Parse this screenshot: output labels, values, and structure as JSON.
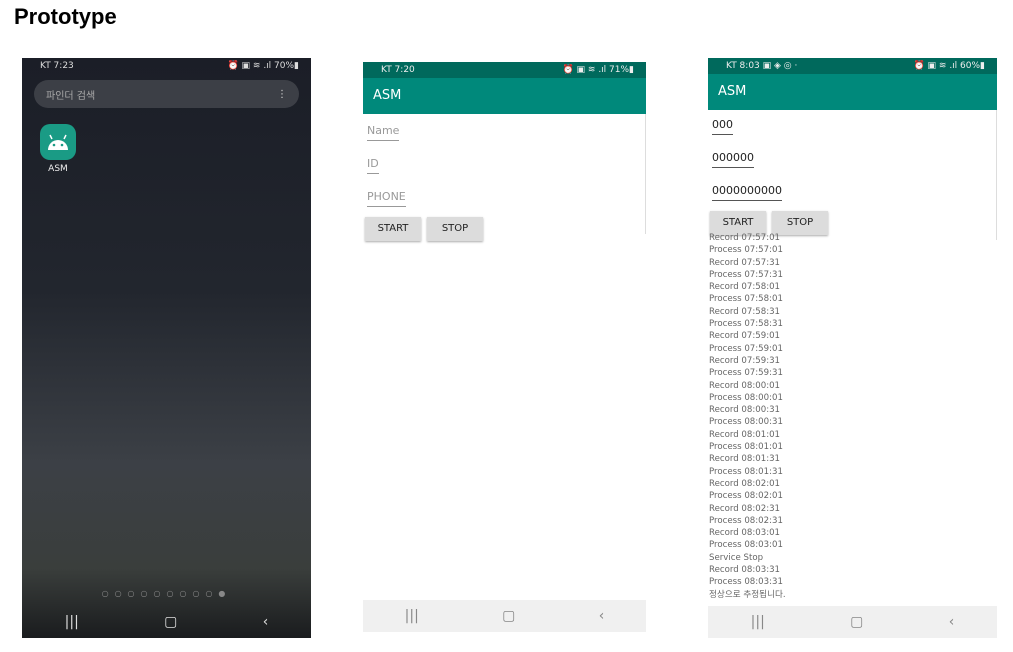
{
  "title": "Prototype",
  "phone1": {
    "carrier_time": "KT 7:23",
    "status_right": "⏰ ▣ ≋ .ıl 70%▮",
    "search_placeholder": "파인더 검색",
    "menu": "⋮",
    "app_label": "ASM",
    "page_dots": "○○○○○○○○○●",
    "nav": [
      "|||",
      "▢",
      "‹"
    ]
  },
  "phone2": {
    "carrier_time": "KT 7:20",
    "status_right": "⏰ ▣ ≋ .ıl 71%▮",
    "app_title": "ASM",
    "fields": [
      "Name",
      "ID",
      "PHONE"
    ],
    "start": "START",
    "stop": "STOP",
    "nav": [
      "|||",
      "▢",
      "‹"
    ]
  },
  "phone3": {
    "carrier_time": "KT 8:03 ▣ ◈ ◎ ·",
    "status_right": "⏰ ▣ ≋ .ıl 60%▮",
    "app_title": "ASM",
    "fields": [
      "000",
      "000000",
      "0000000000"
    ],
    "start": "START",
    "stop": "STOP",
    "log": [
      "Record 07:57:01",
      "Process 07:57:01",
      "Record 07:57:31",
      "Process 07:57:31",
      "Record 07:58:01",
      "Process 07:58:01",
      "Record 07:58:31",
      "Process 07:58:31",
      "Record 07:59:01",
      "Process 07:59:01",
      "Record 07:59:31",
      "Process 07:59:31",
      "Record 08:00:01",
      "Process 08:00:01",
      "Record 08:00:31",
      "Process 08:00:31",
      "Record 08:01:01",
      "Process 08:01:01",
      "Record 08:01:31",
      "Process 08:01:31",
      "Record 08:02:01",
      "Process 08:02:01",
      "Record 08:02:31",
      "Process 08:02:31",
      "Record 08:03:01",
      "Process 08:03:01",
      "Service Stop",
      "Record 08:03:31",
      "Process 08:03:31",
      "정상으로 추정됩니다."
    ],
    "nav": [
      "|||",
      "▢",
      "‹"
    ]
  }
}
